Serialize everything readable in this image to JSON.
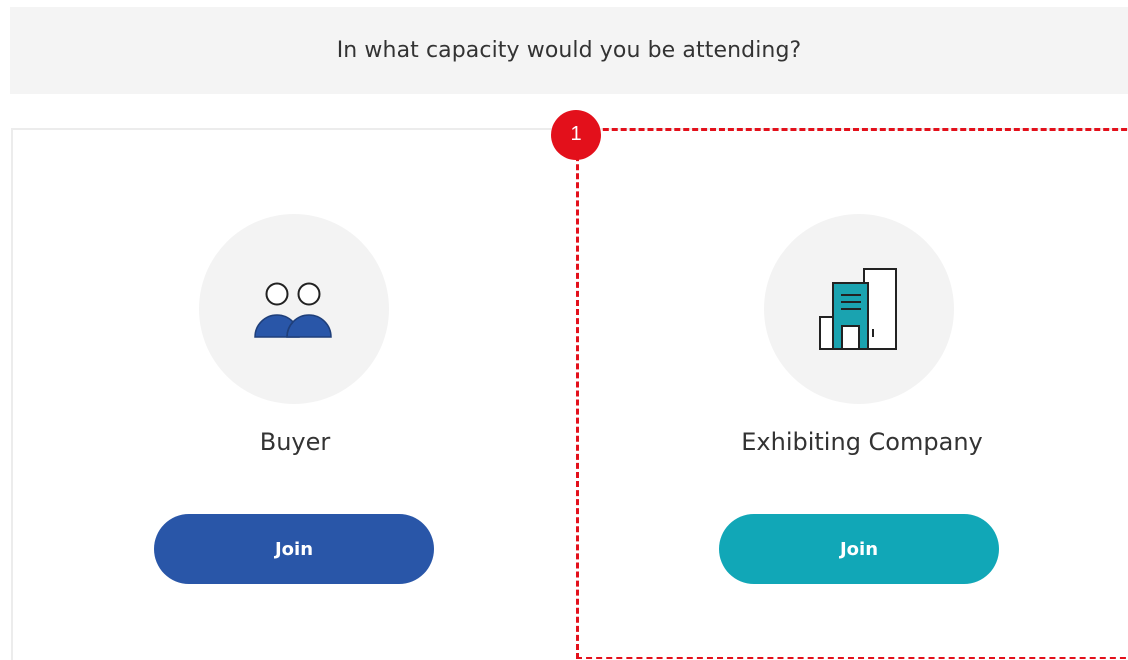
{
  "header": {
    "question": "In what capacity would you be attending?"
  },
  "cards": [
    {
      "id": "buyer",
      "title": "Buyer",
      "icon": "people-icon",
      "button_label": "Join",
      "button_color": "#2956a8",
      "icon_color": "#2956a8"
    },
    {
      "id": "exhibitor",
      "title": "Exhibiting Company",
      "icon": "building-icon",
      "button_label": "Join",
      "button_color": "#11a7b7",
      "icon_color": "#1aa3b0"
    }
  ],
  "annotation": {
    "marker_label": "1",
    "marker_color": "#e3101b"
  }
}
